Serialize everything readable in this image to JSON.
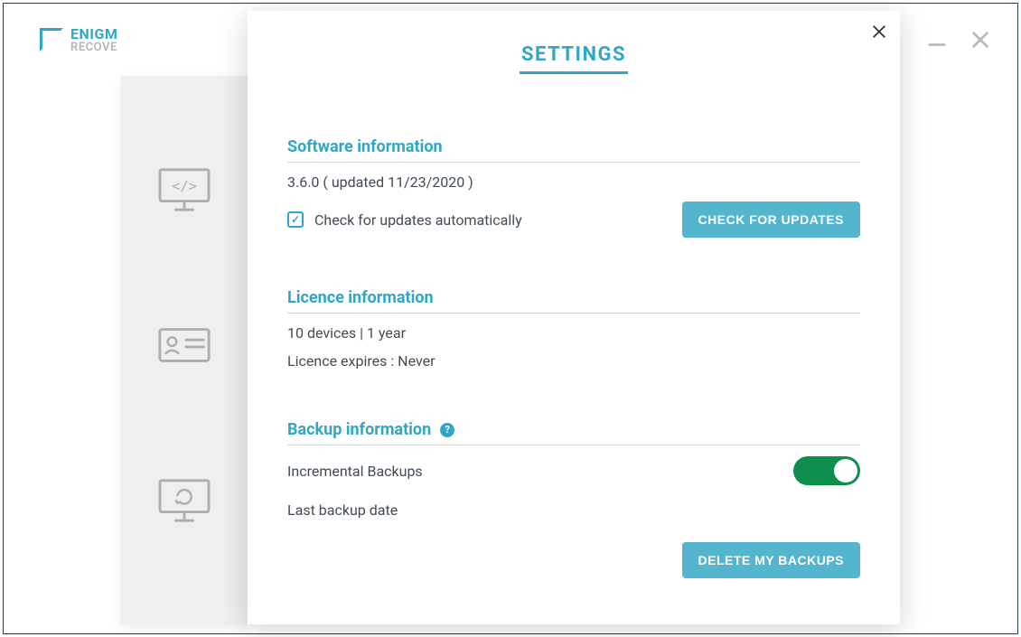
{
  "logo": {
    "line1": "ENIGM",
    "line2": "RECOVE"
  },
  "modal": {
    "title": "SETTINGS",
    "software": {
      "heading": "Software information",
      "version_line": "3.6.0 ( updated 11/23/2020 )",
      "checkbox_label": "Check for updates automatically",
      "check_updates_btn": "CHECK FOR UPDATES"
    },
    "licence": {
      "heading": "Licence information",
      "summary": "10 devices | 1 year",
      "expires": "Licence expires : Never"
    },
    "backup": {
      "heading": "Backup information",
      "incremental_label": "Incremental Backups",
      "last_backup_label": "Last backup date",
      "delete_btn": "DELETE MY BACKUPS"
    }
  }
}
